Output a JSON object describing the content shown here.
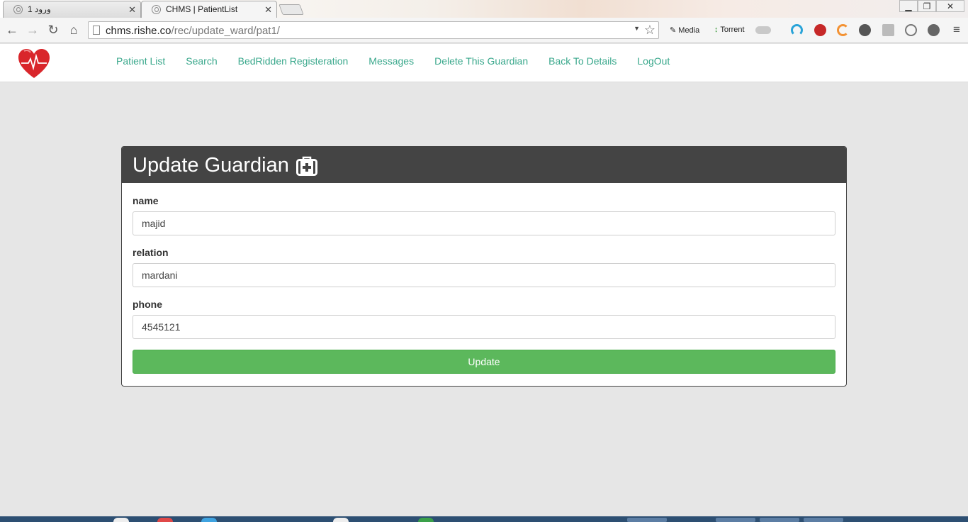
{
  "browser": {
    "tabs": [
      {
        "title": "ورود 1",
        "active": false
      },
      {
        "title": "CHMS | PatientList",
        "active": true
      }
    ],
    "url_host": "chms.rishe.co",
    "url_path": "/rec/update_ward/pat1/",
    "extensions": {
      "media_label": "Media",
      "torrent_label": "Torrent"
    }
  },
  "navbar": {
    "links": [
      "Patient List",
      "Search",
      "BedRidden Registeration",
      "Messages",
      "Delete This Guardian",
      "Back To Details",
      "LogOut"
    ]
  },
  "panel": {
    "title": "Update Guardian",
    "fields": [
      {
        "label": "name",
        "value": "majid"
      },
      {
        "label": "relation",
        "value": "mardani"
      },
      {
        "label": "phone",
        "value": "4545121"
      }
    ],
    "submit_label": "Update"
  },
  "colors": {
    "accent_link": "#3aa88c",
    "panel_header": "#444444",
    "button_green": "#5cb85c",
    "logo_red": "#d9262b"
  }
}
